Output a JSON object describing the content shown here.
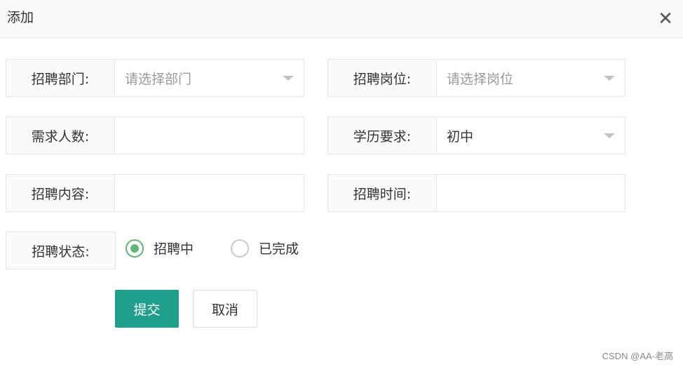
{
  "dialog": {
    "title": "添加",
    "close_glyph": "✕"
  },
  "form": {
    "department": {
      "label": "招聘部门:",
      "placeholder": "请选择部门"
    },
    "position": {
      "label": "招聘岗位:",
      "placeholder": "请选择岗位"
    },
    "headcount": {
      "label": "需求人数:",
      "value": ""
    },
    "education": {
      "label": "学历要求:",
      "value": "初中"
    },
    "content": {
      "label": "招聘内容:",
      "value": ""
    },
    "time": {
      "label": "招聘时间:",
      "value": ""
    },
    "status": {
      "label": "招聘状态:",
      "options": [
        {
          "label": "招聘中",
          "checked": true
        },
        {
          "label": "已完成",
          "checked": false
        }
      ]
    }
  },
  "buttons": {
    "submit": "提交",
    "cancel": "取消"
  },
  "watermark": "CSDN @AA-老高",
  "colors": {
    "accent": "#1e9f8b",
    "radio_checked": "#5fb878"
  }
}
